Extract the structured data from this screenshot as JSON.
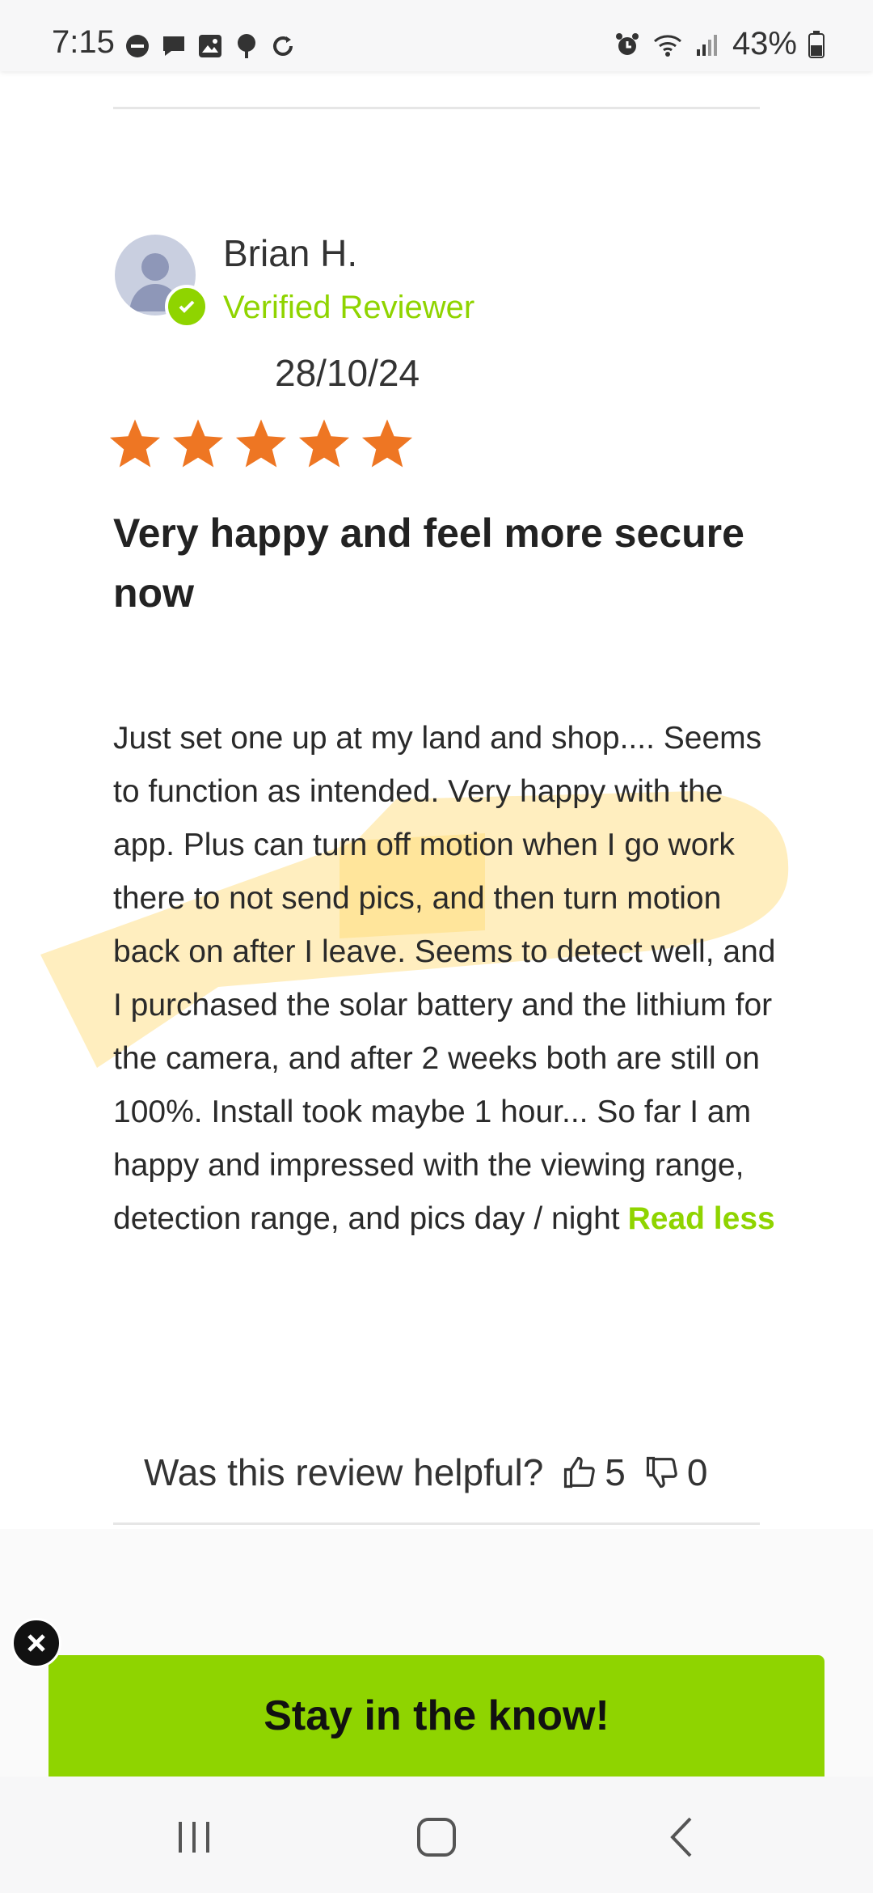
{
  "status_bar": {
    "time": "7:15",
    "battery": "43%"
  },
  "review": {
    "reviewer_name": "Brian H.",
    "verified_label": "Verified Reviewer",
    "date": "28/10/24",
    "rating": 5,
    "rating_max": 5,
    "title": "Very happy and feel more secure now",
    "body": "Just set one up at my land and shop.... Seems to function as intended. Very happy with the app. Plus can turn off motion when I go work there to not send pics, and then turn motion back on after I leave. Seems to detect well, and I purchased the solar battery and the lithium for the camera, and after 2 weeks both are still on 100%. Install took maybe 1 hour... So far I am happy and impressed with the viewing range, detection range, and pics day / night",
    "read_less_label": "Read less",
    "helpful_question": "Was this review helpful?",
    "upvotes": "5",
    "downvotes": "0"
  },
  "promo": {
    "text": "Stay in the know!"
  },
  "colors": {
    "accent_green": "#8fd400",
    "star_orange": "#ee7623",
    "highlight_yellow": "#ffe08a"
  }
}
